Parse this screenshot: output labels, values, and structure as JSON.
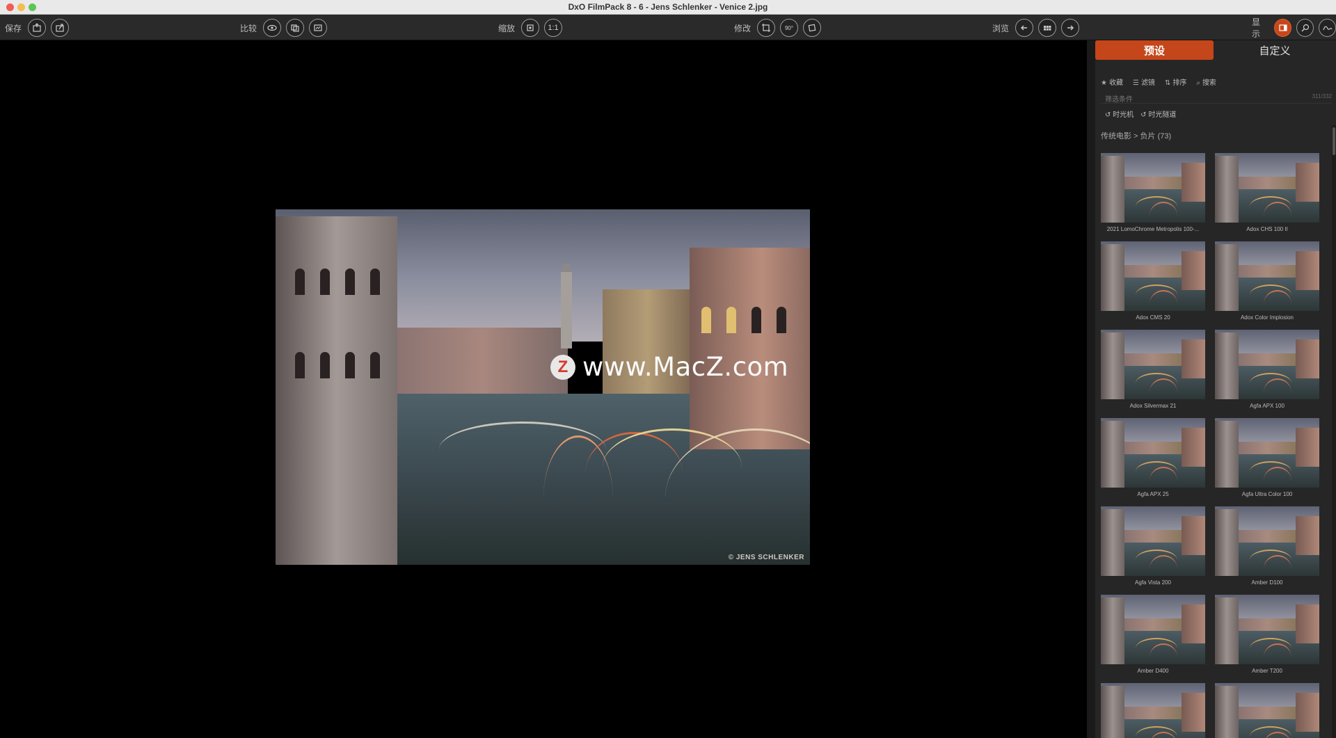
{
  "window": {
    "title": "DxO FilmPack 8 - 6 - Jens Schlenker - Venice 2.jpg"
  },
  "toolbar": {
    "save_label": "保存",
    "compare_label": "比较",
    "zoom_label": "缩放",
    "zoom_one_to_one": "1:1",
    "edit_label": "修改",
    "rotate_label": "90°",
    "browse_label": "浏览",
    "display_label": "显示"
  },
  "viewer": {
    "watermark_text": "www.MacZ.com",
    "watermark_logo": "Z",
    "copyright": "© JENS SCHLENKER"
  },
  "panel": {
    "tabs": [
      {
        "label": "预设",
        "active": true
      },
      {
        "label": "自定义",
        "active": false
      }
    ],
    "filters": [
      {
        "icon": "star-icon",
        "label": "收藏"
      },
      {
        "icon": "list-icon",
        "label": "滤镜"
      },
      {
        "icon": "sort-icon",
        "label": "排序"
      },
      {
        "icon": "search-icon",
        "label": "搜索"
      }
    ],
    "filter_field": {
      "placeholder": "筛选条件",
      "count": "311/332"
    },
    "timers": [
      {
        "icon": "history-icon",
        "label": "时光机"
      },
      {
        "icon": "history-icon",
        "label": "时光隧道"
      }
    ],
    "breadcrumb": "传统电影 > 负片 (73)",
    "presets": [
      "2021 LomoChrome Metropolis 100-...",
      "Adox CHS 100 II",
      "Adox CMS 20",
      "Adox Color Implosion",
      "Adox Silvermax 21",
      "Agfa APX 100",
      "Agfa APX 25",
      "Agfa Ultra Color 100",
      "Agfa Vista 200",
      "Amber D100",
      "Amber D400",
      "Amber T200",
      "",
      ""
    ]
  },
  "colors": {
    "accent": "#c4461a",
    "panel_bg": "#262626",
    "toolbar_bg": "#2a2a2a"
  }
}
